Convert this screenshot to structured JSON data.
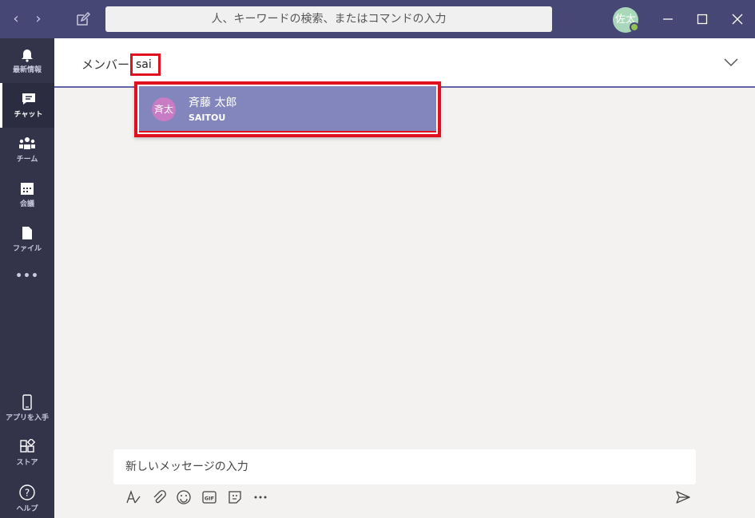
{
  "titlebar": {
    "back_glyph": "‹",
    "forward_glyph": "›",
    "search_placeholder": "人、キーワードの検索、またはコマンドの入力",
    "avatar_initials": "佐太"
  },
  "rail": {
    "items": [
      {
        "label": "最新情報",
        "icon": "bell-icon"
      },
      {
        "label": "チャット",
        "icon": "chat-icon"
      },
      {
        "label": "チーム",
        "icon": "teams-icon"
      },
      {
        "label": "会議",
        "icon": "calendar-icon"
      },
      {
        "label": "ファイル",
        "icon": "file-icon"
      },
      {
        "label": "•••",
        "icon": "more-icon"
      },
      {
        "label": "アプリを入手",
        "icon": "phone-icon"
      },
      {
        "label": "ストア",
        "icon": "store-icon"
      },
      {
        "label": "ヘルプ",
        "icon": "help-icon"
      }
    ]
  },
  "header": {
    "member_label": "メンバー:",
    "member_value": "sai"
  },
  "suggestion": {
    "avatar_initials": "斉太",
    "name": "斉藤 太郎",
    "id": "SAITOU"
  },
  "compose": {
    "placeholder": "新しいメッセージの入力"
  },
  "colors": {
    "titlebar": "#464775",
    "rail": "#33344a",
    "accent": "#6264a7",
    "highlight_border": "#e0101e"
  }
}
